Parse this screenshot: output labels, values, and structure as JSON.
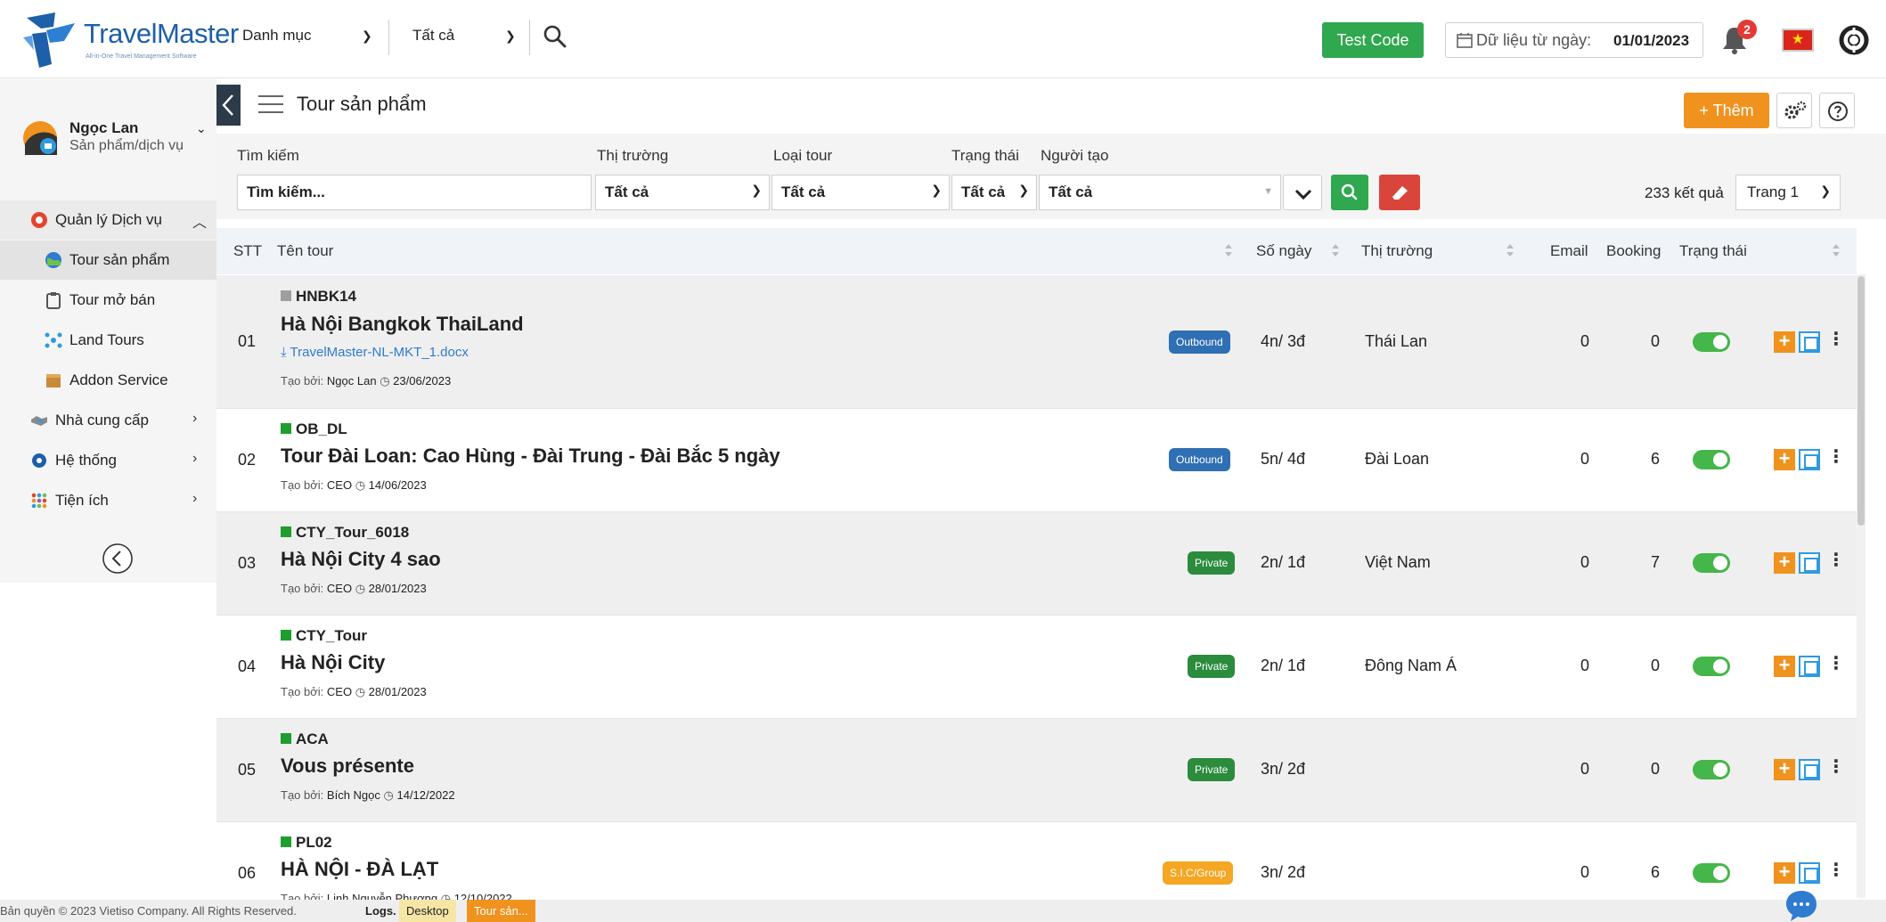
{
  "brand": {
    "name": "TravelMaster",
    "tagline": "All-in-One Travel Management Software"
  },
  "topbar": {
    "category_select": "Danh mục",
    "scope_select": "Tất cả",
    "test_code_label": "Test Code",
    "date_label": "Dữ liệu từ ngày:",
    "date_value": "01/01/2023",
    "notification_count": "2",
    "flag_symbol": "★"
  },
  "user": {
    "name": "Ngọc Lan",
    "role": "Sản phẩm/dịch vụ"
  },
  "sidebar": {
    "items": [
      {
        "label": "Quản lý Dịch vụ",
        "icon": "service-icon",
        "arrow": "︿"
      },
      {
        "label": "Tour sản phẩm",
        "icon": "globe-icon"
      },
      {
        "label": "Tour mở bán",
        "icon": "clipboard-icon"
      },
      {
        "label": "Land Tours",
        "icon": "network-icon"
      },
      {
        "label": "Addon Service",
        "icon": "box-icon"
      },
      {
        "label": "Nhà cung cấp",
        "icon": "handshake-icon",
        "arrow": "›"
      },
      {
        "label": "Hệ thống",
        "icon": "cog-icon",
        "arrow": "›"
      },
      {
        "label": "Tiện ích",
        "icon": "grid-icon",
        "arrow": "›"
      }
    ]
  },
  "page": {
    "title": "Tour sản phẩm",
    "add_label": "+ Thêm"
  },
  "filters": {
    "search_label": "Tìm kiếm",
    "search_placeholder": "Tìm kiếm...",
    "market_label": "Thị trường",
    "market_value": "Tất cả",
    "type_label": "Loại tour",
    "type_value": "Tất cả",
    "status_label": "Trạng thái",
    "status_value": "Tất cả",
    "creator_label": "Người tạo",
    "creator_value": "Tất cả",
    "result_count": "233 kết quả",
    "page_value": "Trang 1"
  },
  "table": {
    "headers": {
      "stt": "STT",
      "name": "Tên tour",
      "days": "Số ngày",
      "market": "Thị trường",
      "email": "Email",
      "booking": "Booking",
      "status": "Trạng thái"
    },
    "rows": [
      {
        "stt": "01",
        "code": "HNBK14",
        "code_color": "#9e9e9e",
        "name": "Hà Nội Bangkok ThaiLand",
        "file": "TravelMaster-NL-MKT_1.docx",
        "created_by_label": "Tạo bởi:",
        "creator": "Ngọc Lan",
        "date": "23/06/2023",
        "tag": "Outbound",
        "days": "4n/ 3đ",
        "market": "Thái Lan",
        "email": "0",
        "booking": "0"
      },
      {
        "stt": "02",
        "code": "OB_DL",
        "code_color": "#1e9e2e",
        "name": "Tour Đài Loan: Cao Hùng - Đài Trung - Đài Bắc 5 ngày",
        "file": "",
        "created_by_label": "Tạo bởi:",
        "creator": "CEO",
        "date": "14/06/2023",
        "tag": "Outbound",
        "days": "5n/ 4đ",
        "market": "Đài Loan",
        "email": "0",
        "booking": "6"
      },
      {
        "stt": "03",
        "code": "CTY_Tour_6018",
        "code_color": "#1e9e2e",
        "name": "Hà Nội City 4 sao",
        "file": "",
        "created_by_label": "Tạo bởi:",
        "creator": "CEO",
        "date": "28/01/2023",
        "tag": "Private",
        "days": "2n/ 1đ",
        "market": "Việt Nam",
        "email": "0",
        "booking": "7"
      },
      {
        "stt": "04",
        "code": "CTY_Tour",
        "code_color": "#1e9e2e",
        "name": "Hà Nội City",
        "file": "",
        "created_by_label": "Tạo bởi:",
        "creator": "CEO",
        "date": "28/01/2023",
        "tag": "Private",
        "days": "2n/ 1đ",
        "market": "Đông Nam Á",
        "email": "0",
        "booking": "0"
      },
      {
        "stt": "05",
        "code": "ACA",
        "code_color": "#1e9e2e",
        "name": "Vous présente",
        "file": "",
        "created_by_label": "Tạo bởi:",
        "creator": "Bích Ngọc",
        "date": "14/12/2022",
        "tag": "Private",
        "days": "3n/ 2đ",
        "market": "",
        "email": "0",
        "booking": "0"
      },
      {
        "stt": "06",
        "code": "PL02",
        "code_color": "#1e9e2e",
        "name": "HÀ NỘI - ĐÀ LẠT",
        "file": "",
        "created_by_label": "Tạo bởi:",
        "creator": "Linh Nguyễn Phương",
        "date": "12/10/2022",
        "tag": "S.I.C/Group",
        "days": "3n/ 2đ",
        "market": "",
        "email": "0",
        "booking": "6"
      }
    ]
  },
  "footer": {
    "copyright": "Bản quyền © 2023 Vietiso Company. All Rights Reserved.",
    "logs": "Logs.",
    "tab_desktop": "Desktop",
    "tab_current": "Tour sản..."
  }
}
